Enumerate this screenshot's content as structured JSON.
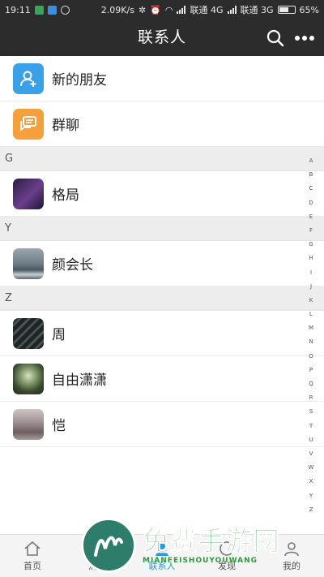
{
  "status_bar": {
    "time": "19:11",
    "speed": "2.09K/s",
    "carrier1": "联通 4G",
    "carrier2": "联通 3G",
    "battery": "65%",
    "battery_level": 0.65
  },
  "header": {
    "title": "联系人",
    "search_icon": "search-icon",
    "more_icon": "more-icon"
  },
  "top_items": [
    {
      "label": "新的朋友",
      "icon": "add-friend-icon",
      "color": "#3aa0e8"
    },
    {
      "label": "群聊",
      "icon": "group-chat-icon",
      "color": "#f5a03c"
    }
  ],
  "sections": [
    {
      "letter": "G",
      "contacts": [
        {
          "name": "格局",
          "avatar_color": "#3b2a58"
        }
      ]
    },
    {
      "letter": "Y",
      "contacts": [
        {
          "name": "颜会长",
          "avatar_color": "#6d7c86"
        }
      ]
    },
    {
      "letter": "Z",
      "contacts": [
        {
          "name": "周",
          "avatar_color": "#2c3132"
        },
        {
          "name": "自由潇潇",
          "avatar_color": "#5d6e4a"
        },
        {
          "name": "恺",
          "avatar_color": "#8b7f83"
        }
      ]
    }
  ],
  "index_letters": [
    "A",
    "B",
    "C",
    "D",
    "E",
    "F",
    "G",
    "H",
    "I",
    "J",
    "K",
    "L",
    "M",
    "N",
    "O",
    "P",
    "Q",
    "R",
    "S",
    "T",
    "U",
    "V",
    "W",
    "X",
    "Y",
    "Z"
  ],
  "tabbar": {
    "tabs": [
      {
        "label": "首页",
        "icon": "home-icon"
      },
      {
        "label": "消息",
        "icon": "message-icon"
      },
      {
        "label": "联系人",
        "icon": "contacts-icon"
      },
      {
        "label": "发现",
        "icon": "discover-icon"
      },
      {
        "label": "我的",
        "icon": "profile-icon"
      }
    ]
  },
  "watermark": {
    "title": "免费手游网",
    "subtitle": "MIANFEISHOUYOUWANG"
  },
  "colors": {
    "header_bg": "#2c2c2c",
    "section_bg": "#ededed",
    "accent": "#2a9be0"
  }
}
